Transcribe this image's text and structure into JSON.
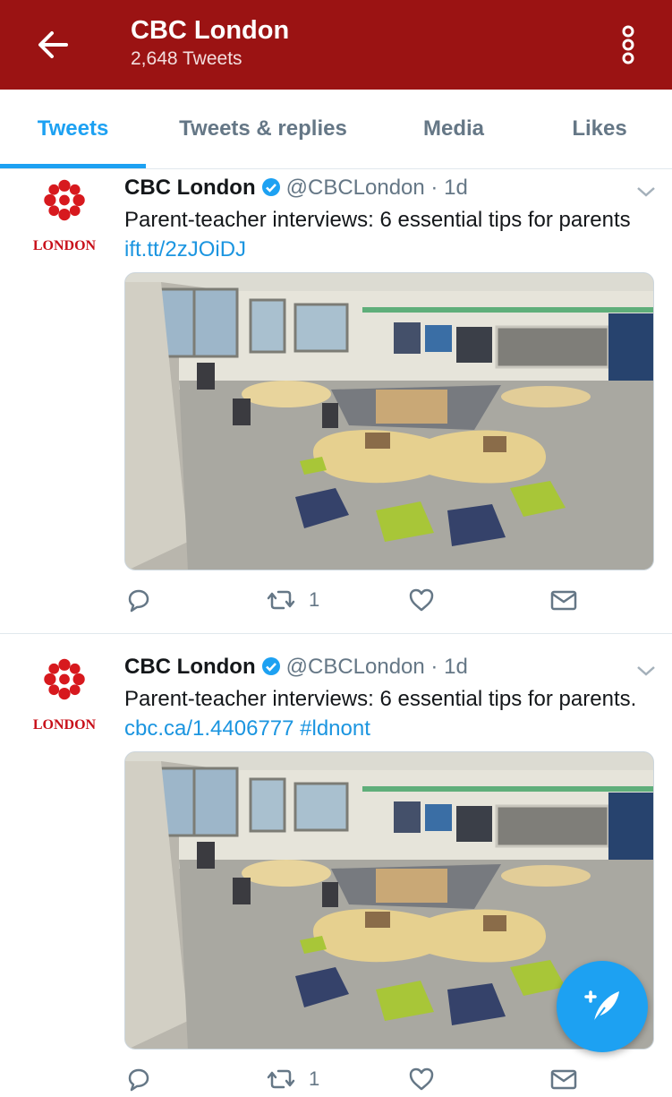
{
  "header": {
    "title": "CBC London",
    "tweet_count": "2,648 Tweets",
    "back_icon": "arrow-left-icon",
    "more_icon": "vertical-dots-icon",
    "bg_color": "#9b1313"
  },
  "tabs": [
    {
      "label": "Tweets",
      "active": true
    },
    {
      "label": "Tweets & replies",
      "active": false
    },
    {
      "label": "Media",
      "active": false
    },
    {
      "label": "Likes",
      "active": false
    }
  ],
  "accent_color": "#1da1f2",
  "tweets": [
    {
      "avatar_label": "LONDON",
      "name": "CBC London",
      "handle": "@CBCLondon",
      "separator": "·",
      "time": "1d",
      "text": "Parent-teacher interviews: 6 essential tips for parents",
      "link": "ift.tt/2zJOiDJ",
      "hashtag": "",
      "media": "classroom-photo",
      "retweet_count": "1"
    },
    {
      "avatar_label": "LONDON",
      "name": "CBC London",
      "handle": "@CBCLondon",
      "separator": "·",
      "time": "1d",
      "text": "Parent-teacher interviews: 6 essential tips for parents.",
      "link": "cbc.ca/1.4406777",
      "hashtag": "#ldnont",
      "media": "classroom-photo",
      "retweet_count": "1"
    }
  ],
  "fab": {
    "icon": "compose-tweet-icon"
  }
}
